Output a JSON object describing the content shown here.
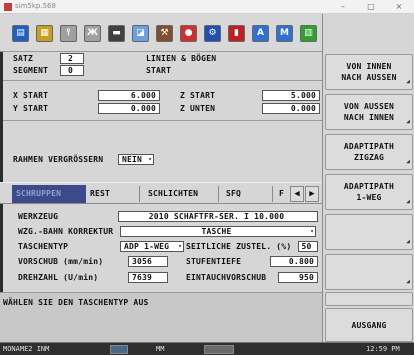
{
  "window": {
    "title": "sim5kp.568",
    "minimize": "–",
    "maximize": "□",
    "close": "×"
  },
  "toolbar": {
    "icons": [
      {
        "name": "program-icon",
        "color": "#2060c0",
        "glyph": "▤"
      },
      {
        "name": "graph-icon",
        "color": "#c8a020",
        "glyph": "▦"
      },
      {
        "name": "tool-icon",
        "color": "#a0a0a0",
        "glyph": "⫯"
      },
      {
        "name": "cut-icon",
        "color": "#a0a0a0",
        "glyph": "Ж"
      },
      {
        "name": "machine-icon",
        "color": "#404040",
        "glyph": "▬"
      },
      {
        "name": "chart-icon",
        "color": "#6aa0e0",
        "glyph": "◪"
      },
      {
        "name": "tools-icon",
        "color": "#805030",
        "glyph": "⚒"
      },
      {
        "name": "colors-icon",
        "color": "#d03030",
        "glyph": "●"
      },
      {
        "name": "gear-icon",
        "color": "#2050b0",
        "glyph": "⚙"
      },
      {
        "name": "flag-icon",
        "color": "#c02020",
        "glyph": "▮"
      },
      {
        "name": "auto-icon",
        "color": "#3070d0",
        "glyph": "A"
      },
      {
        "name": "auto-man-icon",
        "color": "#3070d0",
        "glyph": "M"
      },
      {
        "name": "book-icon",
        "color": "#30a030",
        "glyph": "▥"
      },
      {
        "name": "settings-icon",
        "color": "#a03030",
        "glyph": "⚙"
      },
      {
        "name": "help-icon",
        "color": "#e0c020",
        "glyph": "?"
      }
    ]
  },
  "header": {
    "satz_label": "SATZ",
    "satz_value": "2",
    "segment_label": "SEGMENT",
    "segment_value": "0",
    "line1": "LINIEN & BÖGEN",
    "line2": "START"
  },
  "coords": {
    "x_start_label": "X START",
    "x_start_value": "6.000",
    "y_start_label": "Y START",
    "y_start_value": "0.000",
    "z_start_label": "Z START",
    "z_start_value": "5.000",
    "z_unten_label": "Z UNTEN",
    "z_unten_value": "0.000"
  },
  "frame": {
    "label": "RAHMEN VERGRÖSSERN",
    "value": "NEIN"
  },
  "tabs": {
    "active": "SCHRUPPEN",
    "rest": "REST",
    "schlichten": "SCHLICHTEN",
    "sfq": "SFQ",
    "more": "F"
  },
  "form": {
    "werkzeug_label": "WERKZEUG",
    "werkzeug_value": "2010 SCHAFTFR-SER. I 10.000",
    "bahn_label": "WZG.-BAHN KORREKTUR",
    "bahn_value": "TASCHE",
    "taschentyp_label": "TASCHENTYP",
    "taschentyp_value": "ADP 1-WEG",
    "seitl_label": "SEITLICHE ZUSTEL. (%)",
    "seitl_value": "50",
    "vorschub_label": "VORSCHUB (mm/min)",
    "vorschub_value": "3056",
    "stufentiefe_label": "STUFENTIEFE",
    "stufentiefe_value": "0.800",
    "drehzahl_label": "DREHZAHL (U/min)",
    "drehzahl_value": "7639",
    "eintauch_label": "EINTAUCHVORSCHUB",
    "eintauch_value": "950"
  },
  "message": "WÄHLEN SIE DEN TASCHENTYP AUS",
  "softkeys": {
    "k1": "VON INNEN\nNACH AUSSEN",
    "k2": "VON AUSSEN\nNACH INNEN",
    "k3": "ADAPTIPATH\nZIGZAG",
    "k4": "ADAPTIPATH\n1-WEG",
    "k5": "",
    "k6": "",
    "k7": "",
    "k8": "AUSGANG"
  },
  "status": {
    "left": "MONAME2 INM",
    "mid": "MM",
    "time": "12:59 PM"
  }
}
